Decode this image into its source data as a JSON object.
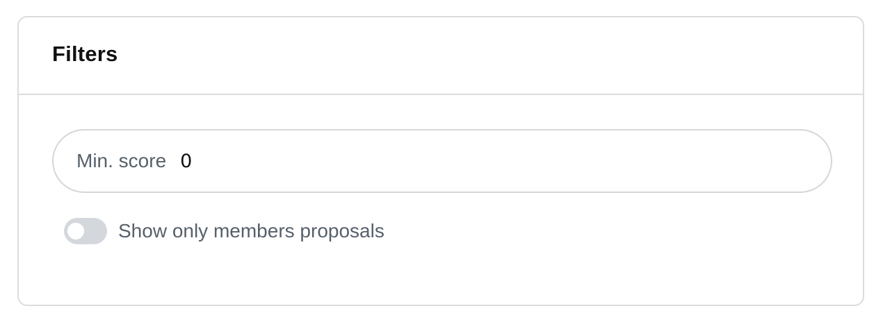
{
  "filters": {
    "title": "Filters",
    "min_score": {
      "label": "Min. score",
      "value": "0"
    },
    "members_toggle": {
      "label": "Show only members proposals",
      "checked": false
    }
  },
  "colors": {
    "border": "#dcdcdc",
    "title_text": "#111111",
    "muted_text": "#57606a",
    "toggle_off": "#d4d7dc"
  }
}
